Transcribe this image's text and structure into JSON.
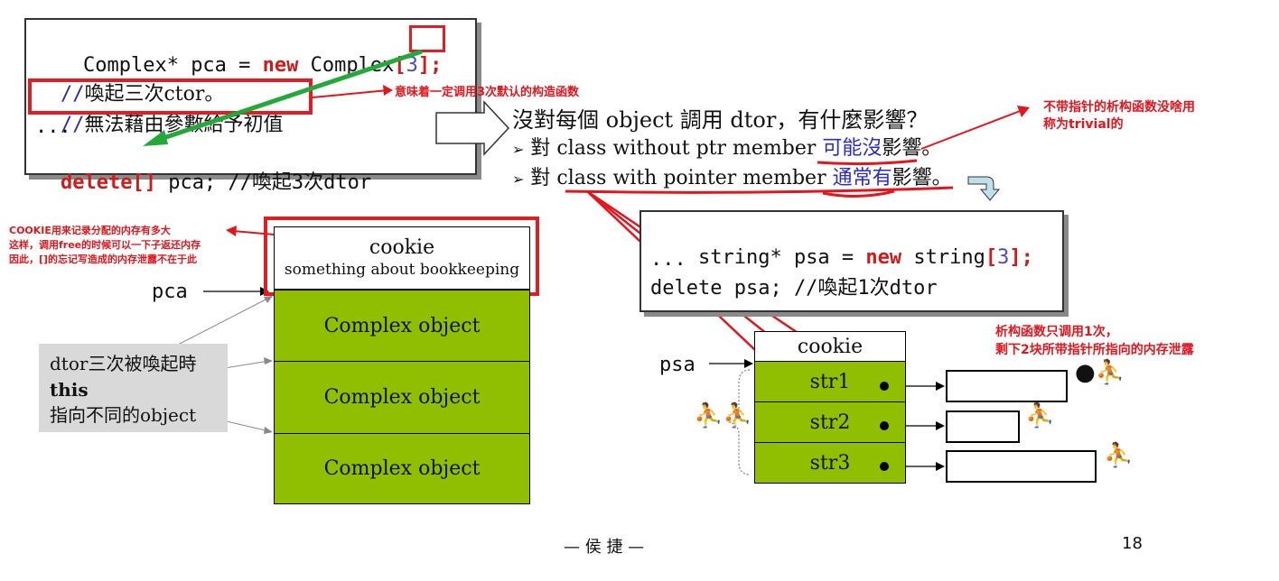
{
  "code1": {
    "line1": {
      "pre": "Complex* pca = ",
      "kw": "new",
      "mid": " Complex",
      "lb": "[",
      "num": "3",
      "rb": "];"
    },
    "line2": {
      "slashes": "//",
      "text": "喚起三次ctor。"
    },
    "line3": {
      "slashes": "//",
      "text": "無法藉由參數給予初值"
    },
    "line4": "...",
    "line5": {
      "kw": "delete[]",
      "rest": " pca; //喚起3次dtor"
    }
  },
  "ann_default_ctor": "意味着一定调用3次默认的构造函数",
  "question": {
    "title": "沒對每個 object 調用 dtor，有什麼影響？",
    "b1_marker": "➢",
    "b1_pre": "對 class without ptr member ",
    "b1_blue": "可能沒",
    "b1_post": "影響。",
    "b2_marker": "➢",
    "b2_pre": "對 class with pointer member ",
    "b2_blue": "通常有",
    "b2_post": "影響。"
  },
  "ann_trivial": {
    "line1": "不带指针的析构函数没啥用",
    "line2": "称为trivial的"
  },
  "ann_cookie": {
    "line1": "COOKIE用来记录分配的内存有多大",
    "line2": "这样，调用free的时候可以一下子返还内存",
    "line3": "因此，[]的忘记写造成的内存泄露不在于此"
  },
  "left_mem": {
    "cookie_title": "cookie",
    "cookie_sub": "something about bookkeeping",
    "pointer_label": "pca",
    "objects": [
      "Complex object",
      "Complex object",
      "Complex object"
    ]
  },
  "dtor_note": {
    "line1": "dtor三次被喚起時",
    "line2": "this",
    "line3": "指向不同的object"
  },
  "code2": {
    "line1": {
      "pre": "string* psa = ",
      "kw": "new",
      "mid": " string",
      "lb": "[",
      "num": "3",
      "rb": "];"
    },
    "line2": "...",
    "line3": "delete psa; //喚起1次dtor"
  },
  "ann_leak": {
    "line1": "析构函数只调用1次，",
    "line2": "剩下2块所带指针所指向的内存泄露"
  },
  "right_mem": {
    "pointer_label": "psa",
    "cookie_title": "cookie",
    "cells": [
      "str1",
      "str2",
      "str3"
    ]
  },
  "footer": {
    "author": "— 侯 捷 —",
    "page": "18"
  },
  "colors": {
    "annotation": "#e8141b",
    "object_fill": "#8fbf00",
    "comment": "#2a2ab0",
    "keyword": "#d11a1a"
  }
}
